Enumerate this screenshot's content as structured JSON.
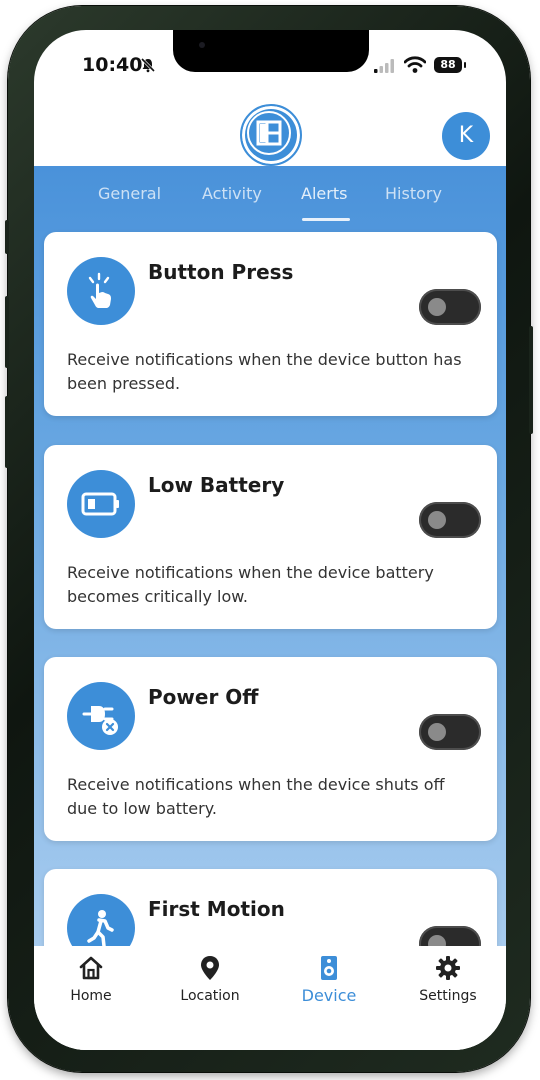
{
  "status_bar": {
    "time": "10:40",
    "battery": "88",
    "icons": [
      "bell-slash-icon",
      "signal-icon",
      "wifi-icon",
      "battery-icon"
    ]
  },
  "header": {
    "logo_icon": "app-logo-icon",
    "avatar_initial": "K"
  },
  "tabs": [
    {
      "label": "General",
      "active": false
    },
    {
      "label": "Activity",
      "active": false
    },
    {
      "label": "Alerts",
      "active": true
    },
    {
      "label": "History",
      "active": false
    }
  ],
  "alerts": [
    {
      "title": "Button Press",
      "description": "Receive notifications when the device button has been pressed.",
      "icon": "hand-tap-icon",
      "enabled": false
    },
    {
      "title": "Low Battery",
      "description": "Receive notifications when the device battery becomes critically low.",
      "icon": "battery-low-icon",
      "enabled": false
    },
    {
      "title": "Power Off",
      "description": "Receive notifications when the device shuts off due to low battery.",
      "icon": "plug-off-icon",
      "enabled": false
    },
    {
      "title": "First Motion",
      "description": "",
      "icon": "walking-person-icon",
      "enabled": false
    }
  ],
  "bottom_nav": [
    {
      "label": "Home",
      "icon": "home-icon",
      "active": false
    },
    {
      "label": "Location",
      "icon": "location-pin-icon",
      "active": false
    },
    {
      "label": "Device",
      "icon": "speaker-device-icon",
      "active": true
    },
    {
      "label": "Settings",
      "icon": "gear-icon",
      "active": false
    }
  ],
  "colors": {
    "accent": "#3d8ed8",
    "tab_bar": "#4a92da",
    "toggle_off": "#2b2b2b"
  }
}
